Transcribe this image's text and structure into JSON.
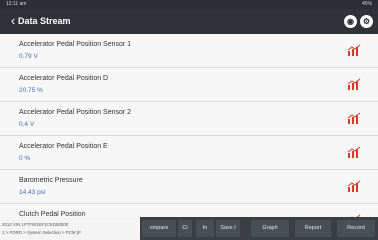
{
  "status_bar": {
    "time": "12:11 am",
    "battery": "45%"
  },
  "header": {
    "title": "Data Stream",
    "back_icon": "back-chevron-icon",
    "icon_a": "record-icon",
    "icon_b": "settings-icon"
  },
  "rows": [
    {
      "name": "Accelerator Pedal Position Sensor 1",
      "value": "0.79 V"
    },
    {
      "name": "Accelerator Pedal Position D",
      "value": "20.75 %"
    },
    {
      "name": "Accelerator Pedal Position Sensor 2",
      "value": "0.4 V"
    },
    {
      "name": "Accelerator Pedal Position E",
      "value": "0 %"
    },
    {
      "name": "Barometric Pressure",
      "value": "14.43 psi"
    },
    {
      "name": "Clutch Pedal Position",
      "value": ""
    }
  ],
  "vehicle_info": {
    "line1": "2012  VIN  1FTFW1EF1CKD00000",
    "line2": "1 > FORD > System Selection > PCM  [P"
  },
  "toolbar": {
    "compare": "ompare",
    "ci": "Ci",
    "in": "In",
    "save": "Save I",
    "graph": "Graph",
    "report": "Report",
    "record": "Record"
  },
  "accent_color": "#d63a2d"
}
